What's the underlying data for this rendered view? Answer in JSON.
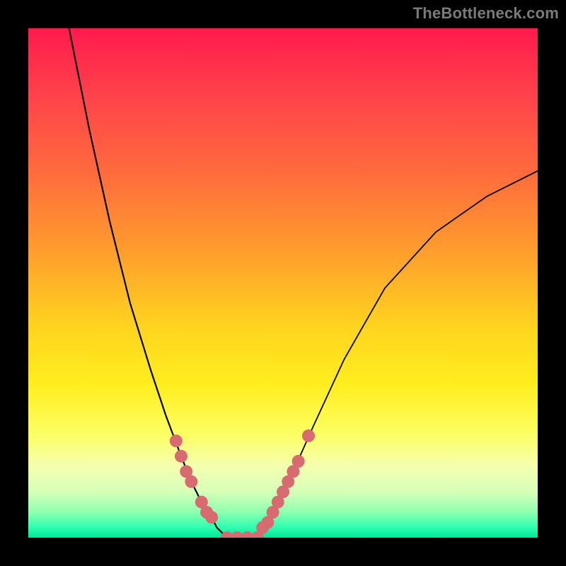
{
  "watermark": "TheBottleneck.com",
  "colors": {
    "background_frame": "#000000",
    "gradient_top": "#ff1a4d",
    "gradient_bottom": "#00e598",
    "curve": "#000000",
    "marker": "#d86b6f"
  },
  "chart_data": {
    "type": "line",
    "title": "",
    "xlabel": "",
    "ylabel": "",
    "xlim": [
      0,
      100
    ],
    "ylim": [
      0,
      100
    ],
    "axes_visible": false,
    "grid": false,
    "legend": false,
    "series": [
      {
        "name": "left-curve",
        "x": [
          8,
          12,
          16,
          20,
          24,
          27,
          30,
          32,
          34,
          36,
          37,
          38,
          39
        ],
        "y": [
          100,
          80,
          62,
          46,
          33,
          24,
          16,
          11,
          7,
          4,
          2,
          1,
          0
        ]
      },
      {
        "name": "valley-floor",
        "x": [
          39,
          41,
          43,
          45
        ],
        "y": [
          0,
          0,
          0,
          0
        ]
      },
      {
        "name": "right-curve",
        "x": [
          45,
          47,
          49,
          52,
          56,
          62,
          70,
          80,
          90,
          100
        ],
        "y": [
          0,
          3,
          7,
          13,
          22,
          35,
          49,
          60,
          67,
          72
        ]
      }
    ],
    "markers": [
      {
        "series": "left-curve",
        "x": 29,
        "y": 19
      },
      {
        "series": "left-curve",
        "x": 30,
        "y": 16
      },
      {
        "series": "left-curve",
        "x": 31,
        "y": 13
      },
      {
        "series": "left-curve",
        "x": 32,
        "y": 11
      },
      {
        "series": "left-curve",
        "x": 34,
        "y": 7
      },
      {
        "series": "left-curve",
        "x": 35,
        "y": 5
      },
      {
        "series": "left-curve",
        "x": 36,
        "y": 4
      },
      {
        "series": "valley-floor",
        "x": 39,
        "y": 0
      },
      {
        "series": "valley-floor",
        "x": 41,
        "y": 0
      },
      {
        "series": "valley-floor",
        "x": 43,
        "y": 0
      },
      {
        "series": "valley-floor",
        "x": 45,
        "y": 0
      },
      {
        "series": "right-curve",
        "x": 46,
        "y": 2
      },
      {
        "series": "right-curve",
        "x": 47,
        "y": 3
      },
      {
        "series": "right-curve",
        "x": 48,
        "y": 5
      },
      {
        "series": "right-curve",
        "x": 49,
        "y": 7
      },
      {
        "series": "right-curve",
        "x": 50,
        "y": 9
      },
      {
        "series": "right-curve",
        "x": 51,
        "y": 11
      },
      {
        "series": "right-curve",
        "x": 52,
        "y": 13
      },
      {
        "series": "right-curve",
        "x": 53,
        "y": 15
      },
      {
        "series": "right-curve",
        "x": 55,
        "y": 20
      }
    ]
  }
}
